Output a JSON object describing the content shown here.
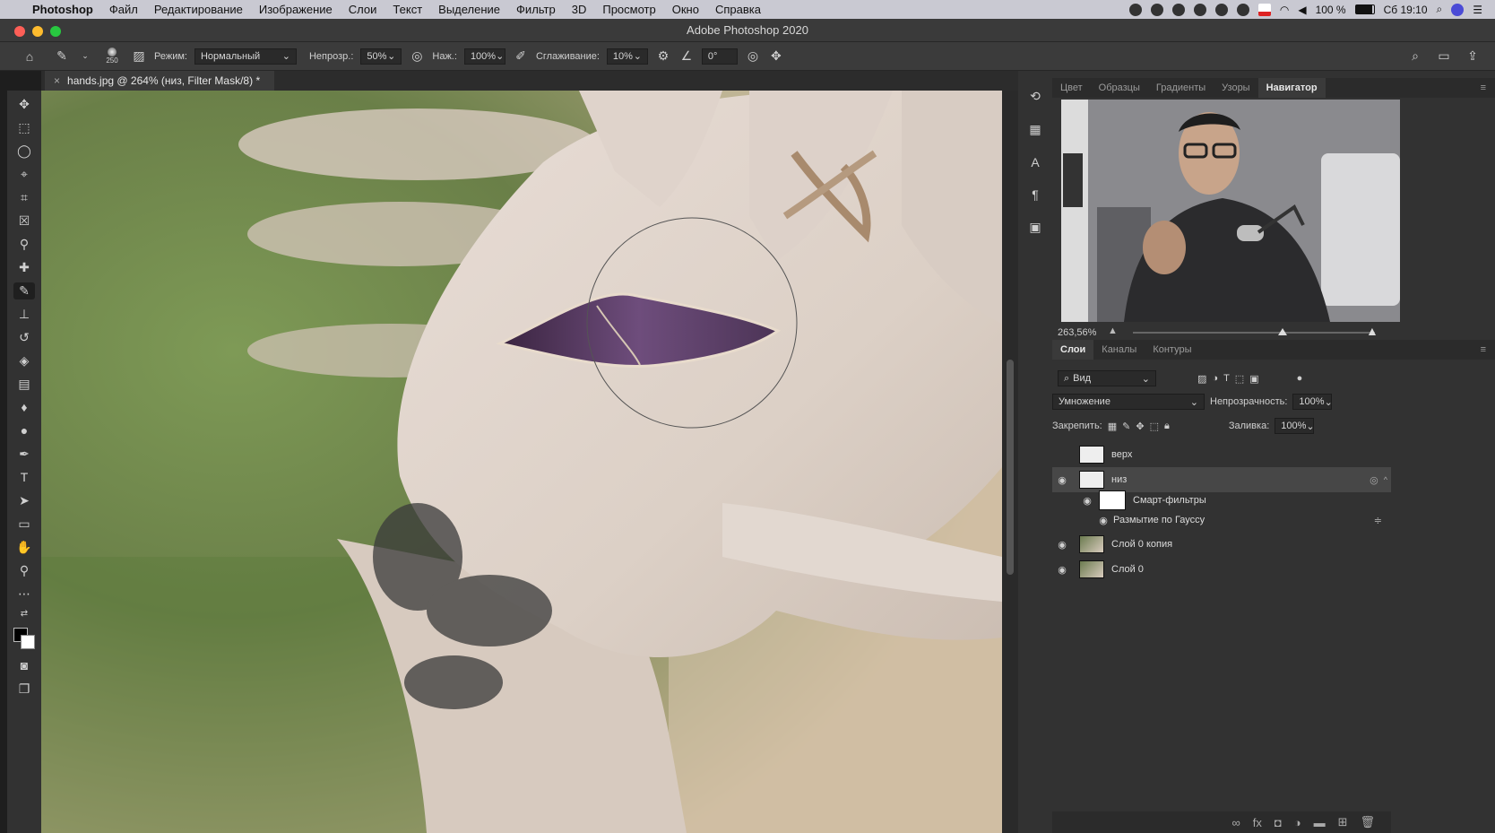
{
  "menubar": {
    "apple_glyph": "",
    "app_name": "Photoshop",
    "items": [
      "Файл",
      "Редактирование",
      "Изображение",
      "Слои",
      "Текст",
      "Выделение",
      "Фильтр",
      "3D",
      "Просмотр",
      "Окно",
      "Справка"
    ],
    "battery": "100 %",
    "clock": "Сб 19:10"
  },
  "window": {
    "title": "Adobe Photoshop 2020"
  },
  "options_bar": {
    "brush_size": "250",
    "mode_label": "Режим:",
    "mode_value": "Нормальный",
    "opacity_label": "Непрозр.:",
    "opacity_value": "50%",
    "pressure_label": "Наж.:",
    "pressure_value": "100%",
    "smoothing_label": "Сглаживание:",
    "smoothing_value": "10%",
    "angle_value": "0°"
  },
  "document": {
    "close_glyph": "×",
    "tab_title": "hands.jpg @ 264% (низ, Filter Mask/8) *"
  },
  "top_panel": {
    "tabs": [
      {
        "label": "Цвет"
      },
      {
        "label": "Образцы"
      },
      {
        "label": "Градиенты"
      },
      {
        "label": "Узоры"
      },
      {
        "label": "Навигатор"
      }
    ],
    "zoom": "263,56%",
    "zoom_slider_fraction": 0.62
  },
  "layers_panel": {
    "tabs": [
      {
        "label": "Слои"
      },
      {
        "label": "Каналы"
      },
      {
        "label": "Контуры"
      }
    ],
    "filter_label": "Вид",
    "blend_mode": "Умножение",
    "opacity_label": "Непрозрачность:",
    "opacity_value": "100%",
    "lock_label": "Закрепить:",
    "fill_label": "Заливка:",
    "fill_value": "100%",
    "layers": [
      {
        "name": "верх",
        "visible": false
      },
      {
        "name": "низ",
        "visible": true,
        "selected": true
      },
      {
        "name": "Смарт-фильтры",
        "visible": true,
        "kind": "smart-filters"
      },
      {
        "name": "Размытие по Гауссу",
        "visible": true,
        "kind": "filter"
      },
      {
        "name": "Слой 0 копия",
        "visible": true
      },
      {
        "name": "Слой 0",
        "visible": true
      }
    ]
  },
  "colors": {
    "panel_bg": "#323232",
    "menubar_bg": "#c9c9d2",
    "accent_selected_layer": "#474747"
  }
}
